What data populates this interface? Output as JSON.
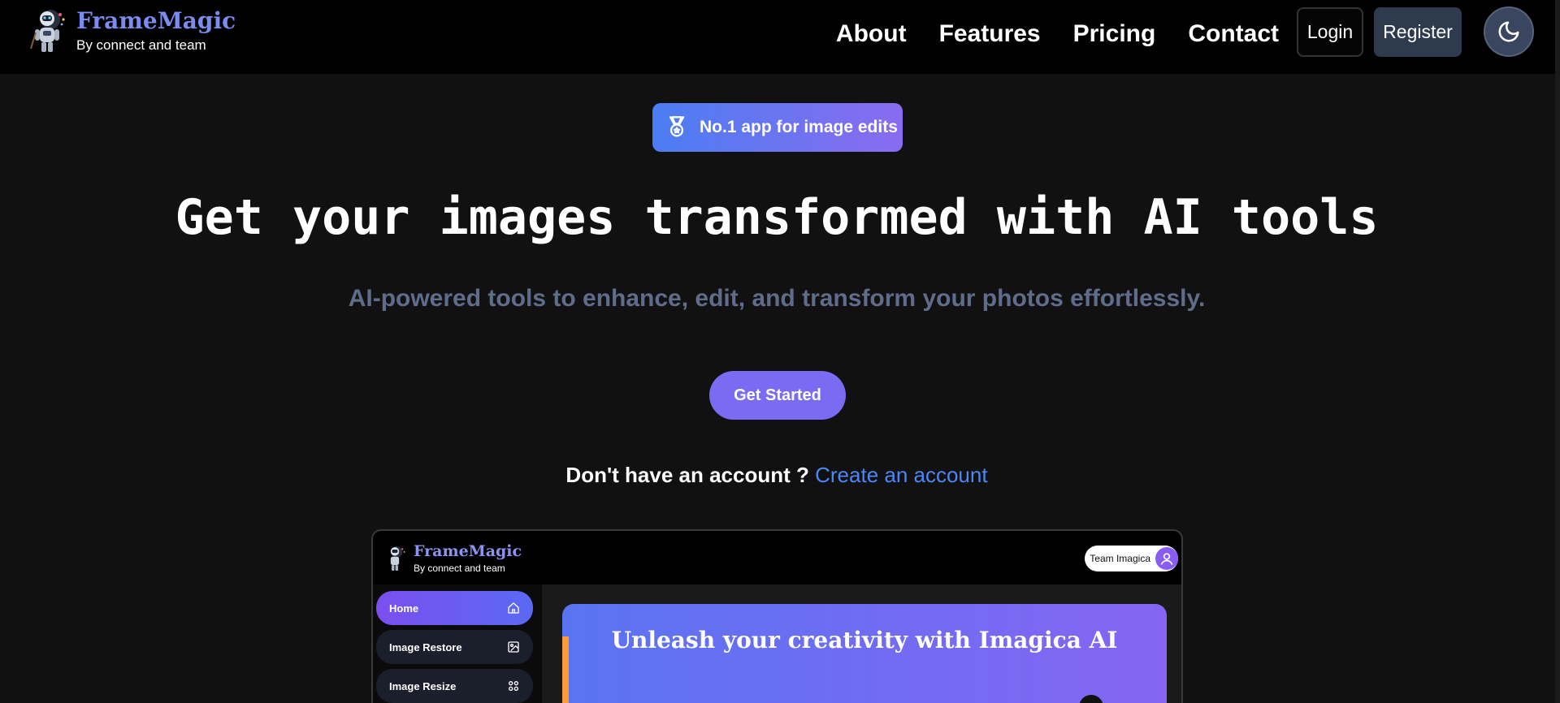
{
  "nav": {
    "brand_title": "FrameMagic",
    "brand_subtitle": "By connect and team",
    "links": [
      "About",
      "Features",
      "Pricing",
      "Contact"
    ],
    "login_label": "Login",
    "register_label": "Register",
    "theme_icon": "moon-icon"
  },
  "hero": {
    "badge_text": "No.1 app for image edits",
    "badge_icon": "medal-icon",
    "title": "Get your images transformed with AI tools",
    "subtitle": "AI-powered tools to enhance, edit, and transform your photos effortlessly.",
    "cta_label": "Get Started",
    "signup_question": "Don't have an account ?",
    "signup_link": "Create an account"
  },
  "preview": {
    "brand_title": "FrameMagic",
    "brand_subtitle": "By connect and team",
    "team_label": "Team Imagica",
    "sidebar": [
      {
        "label": "Home",
        "icon": "home-icon",
        "active": true
      },
      {
        "label": "Image Restore",
        "icon": "image-restore-icon",
        "active": false
      },
      {
        "label": "Image Resize",
        "icon": "resize-icon",
        "active": false
      }
    ],
    "banner_title": "Unleash your creativity with Imagica AI"
  },
  "colors": {
    "background": "#111111",
    "nav_bg": "#000000",
    "brand": "#7b8cf0",
    "accent_purple": "#7a6cf2",
    "link_blue": "#4b87f5",
    "muted_subtitle": "#5f6d8a"
  }
}
